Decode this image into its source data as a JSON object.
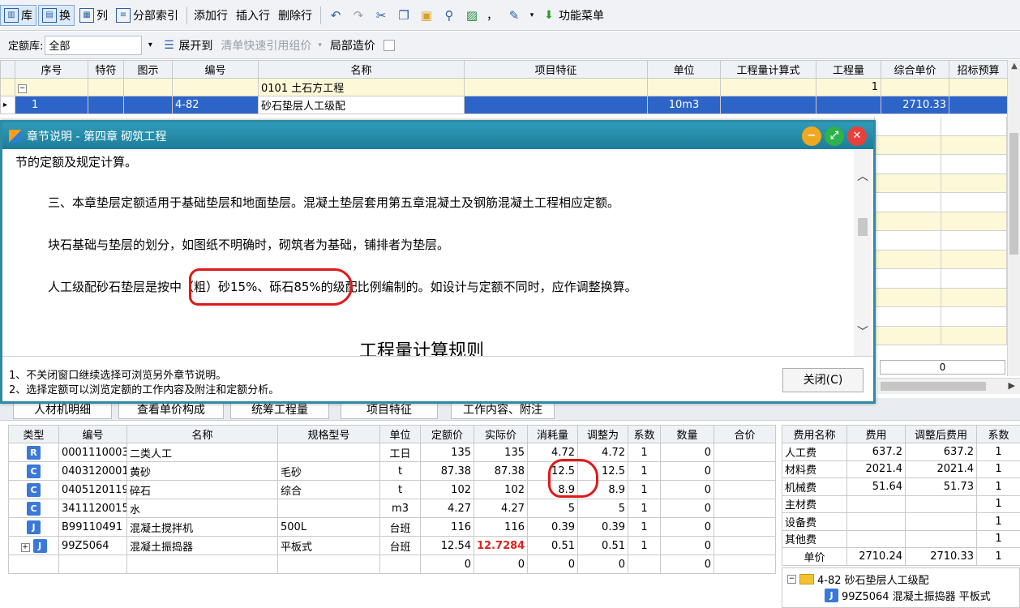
{
  "toolbar1": {
    "lib": "库",
    "swap": "换",
    "col": "列",
    "section_index": "分部索引",
    "add_row": "添加行",
    "insert_row": "插入行",
    "delete_row": "删除行",
    "comma": "，",
    "func_menu": "功能菜单"
  },
  "toolbar2": {
    "quota_label": "定额库:",
    "quota_value": "全部",
    "expand_to": "展开到",
    "quick_ref": "清单快速引用组价",
    "local_cost": "局部造价"
  },
  "upper_grid": {
    "headers": [
      "序号",
      "特符",
      "图示",
      "编号",
      "名称",
      "项目特征",
      "单位",
      "工程量计算式",
      "工程量",
      "综合单价",
      "招标预算"
    ],
    "rows": [
      {
        "seq": "",
        "code": "",
        "name": "0101 土石方工程",
        "unit": "",
        "qty": "1",
        "price": ""
      },
      {
        "seq": "1",
        "code": "4-82",
        "name": "砂石垫层人工级配",
        "unit": "10m3",
        "qty": "",
        "price": "2710.33"
      }
    ],
    "zero_value": "0"
  },
  "dialog": {
    "title": "章节说明 - 第四章 砌筑工程",
    "line0": "节的定额及规定计算。",
    "line1": "三、本章垫层定额适用于基础垫层和地面垫层。混凝土垫层套用第五章混凝土及钢筋混凝土工程相应定额。",
    "line2": "块石基础与垫层的划分，如图纸不明确时，砌筑者为基础，铺排者为垫层。",
    "line3": "人工级配砂石垫层是按中（粗）砂15%、砾石85%的级配比例编制的。如设计与定额不同时，应作调整换算。",
    "line4": "工程量计算规则",
    "note1": "1、不关闭窗口继续选择可浏览另外章节说明。",
    "note2": "2、选择定额可以浏览定额的工作内容及附注和定额分析。",
    "close": "关闭(C)"
  },
  "bottom_tabs": [
    "人材机明细",
    "查看单价构成",
    "统筹工程量",
    "项目特征",
    "工作内容、附注"
  ],
  "material_grid": {
    "headers": [
      "类型",
      "编号",
      "名称",
      "规格型号",
      "单位",
      "定额价",
      "实际价",
      "消耗量",
      "调整为",
      "系数",
      "数量",
      "合价"
    ],
    "rows": [
      {
        "type": "R",
        "code": "0001110003",
        "name": "二类人工",
        "spec": "",
        "unit": "工日",
        "quota": "135",
        "actual": "135",
        "consume": "4.72",
        "adjust": "4.72",
        "coef": "1",
        "qty": "0"
      },
      {
        "type": "C",
        "code": "0403120001",
        "name": "黄砂",
        "spec": "毛砂",
        "unit": "t",
        "quota": "87.38",
        "actual": "87.38",
        "consume": "12.5",
        "adjust": "12.5",
        "coef": "1",
        "qty": "0"
      },
      {
        "type": "C",
        "code": "0405120119",
        "name": "碎石",
        "spec": "综合",
        "unit": "t",
        "quota": "102",
        "actual": "102",
        "consume": "8.9",
        "adjust": "8.9",
        "coef": "1",
        "qty": "0"
      },
      {
        "type": "C",
        "code": "3411120015",
        "name": "水",
        "spec": "",
        "unit": "m3",
        "quota": "4.27",
        "actual": "4.27",
        "consume": "5",
        "adjust": "5",
        "coef": "1",
        "qty": "0"
      },
      {
        "type": "J",
        "code": "B99110491",
        "name": "混凝土搅拌机",
        "spec": "500L",
        "unit": "台班",
        "quota": "116",
        "actual": "116",
        "consume": "0.39",
        "adjust": "0.39",
        "coef": "1",
        "qty": "0"
      },
      {
        "type": "J",
        "code": "99Z5064",
        "name": "混凝土振捣器",
        "spec": "平板式",
        "unit": "台班",
        "quota": "12.54",
        "actual": "12.7284",
        "consume": "0.51",
        "adjust": "0.51",
        "coef": "1",
        "qty": "0"
      },
      {
        "type": "",
        "code": "",
        "name": "",
        "spec": "",
        "unit": "",
        "quota": "0",
        "actual": "0",
        "consume": "0",
        "adjust": "0",
        "coef": "",
        "qty": "0"
      }
    ]
  },
  "fee_grid": {
    "headers": [
      "费用名称",
      "费用",
      "调整后费用",
      "系数"
    ],
    "rows": [
      {
        "name": "人工费",
        "fee": "637.2",
        "adj": "637.2",
        "coef": "1"
      },
      {
        "name": "材料费",
        "fee": "2021.4",
        "adj": "2021.4",
        "coef": "1"
      },
      {
        "name": "机械费",
        "fee": "51.64",
        "adj": "51.73",
        "coef": "1"
      },
      {
        "name": "主材费",
        "fee": "",
        "adj": "",
        "coef": "1"
      },
      {
        "name": "设备费",
        "fee": "",
        "adj": "",
        "coef": "1"
      },
      {
        "name": "其他费",
        "fee": "",
        "adj": "",
        "coef": "1"
      },
      {
        "name": "单价",
        "fee": "2710.24",
        "adj": "2710.33",
        "coef": "1"
      }
    ]
  },
  "tree": {
    "root": "4-82 砂石垫层人工级配",
    "child": "99Z5064 混凝土振捣器 平板式"
  }
}
